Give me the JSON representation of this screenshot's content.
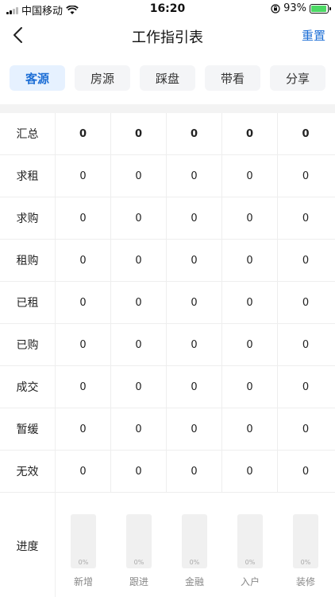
{
  "status": {
    "carrier": "中国移动",
    "time": "16:20",
    "battery": "93%",
    "battery_level": 0.93
  },
  "nav": {
    "title": "工作指引表",
    "reset_label": "重置"
  },
  "tabs": [
    {
      "label": "客源",
      "active": true
    },
    {
      "label": "房源",
      "active": false
    },
    {
      "label": "踩盘",
      "active": false
    },
    {
      "label": "带看",
      "active": false
    },
    {
      "label": "分享",
      "active": false
    }
  ],
  "table": {
    "rows": [
      {
        "label": "汇总",
        "values": [
          "0",
          "0",
          "0",
          "0",
          "0"
        ]
      },
      {
        "label": "求租",
        "values": [
          "0",
          "0",
          "0",
          "0",
          "0"
        ]
      },
      {
        "label": "求购",
        "values": [
          "0",
          "0",
          "0",
          "0",
          "0"
        ]
      },
      {
        "label": "租购",
        "values": [
          "0",
          "0",
          "0",
          "0",
          "0"
        ]
      },
      {
        "label": "已租",
        "values": [
          "0",
          "0",
          "0",
          "0",
          "0"
        ]
      },
      {
        "label": "已购",
        "values": [
          "0",
          "0",
          "0",
          "0",
          "0"
        ]
      },
      {
        "label": "成交",
        "values": [
          "0",
          "0",
          "0",
          "0",
          "0"
        ]
      },
      {
        "label": "暂缓",
        "values": [
          "0",
          "0",
          "0",
          "0",
          "0"
        ]
      },
      {
        "label": "无效",
        "values": [
          "0",
          "0",
          "0",
          "0",
          "0"
        ]
      }
    ]
  },
  "progress": {
    "label": "进度",
    "bars": [
      {
        "name": "新增",
        "pct_text": "0%",
        "value": 0
      },
      {
        "name": "跟进",
        "pct_text": "0%",
        "value": 0
      },
      {
        "name": "金融",
        "pct_text": "0%",
        "value": 0
      },
      {
        "name": "入户",
        "pct_text": "0%",
        "value": 0
      },
      {
        "name": "装修",
        "pct_text": "0%",
        "value": 0
      }
    ]
  },
  "colors": {
    "accent": "#1e6fd6",
    "tab_active_bg": "#e6f1ff"
  }
}
